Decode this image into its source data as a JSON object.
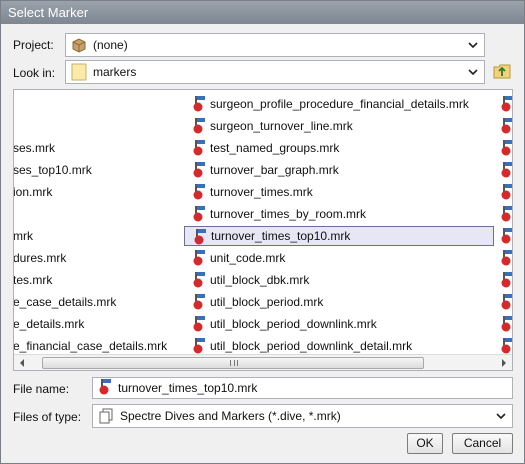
{
  "window": {
    "title": "Select Marker"
  },
  "project": {
    "label": "Project:",
    "value": "(none)"
  },
  "look_in": {
    "label": "Look in:",
    "value": "markers"
  },
  "files": {
    "left_column": [
      "",
      "",
      "ses.mrk",
      "ses_top10.mrk",
      "ion.mrk",
      "",
      "mrk",
      "dures.mrk",
      "tes.mrk",
      "e_case_details.mrk",
      "e_details.mrk",
      "e_financial_case_details.mrk"
    ],
    "middle_column": [
      "surgeon_profile_procedure_financial_details.mrk",
      "surgeon_turnover_line.mrk",
      "test_named_groups.mrk",
      "turnover_bar_graph.mrk",
      "turnover_times.mrk",
      "turnover_times_by_room.mrk",
      "turnover_times_top10.mrk",
      "unit_code.mrk",
      "util_block_dbk.mrk",
      "util_block_period.mrk",
      "util_block_period_downlink.mrk",
      "util_block_period_downlink_detail.mrk"
    ],
    "selected_index": 6
  },
  "file_name": {
    "label": "File name:",
    "value": "turnover_times_top10.mrk"
  },
  "file_type": {
    "label": "Files of type:",
    "value": "Spectre Dives and Markers (*.dive, *.mrk)"
  },
  "buttons": {
    "ok": "OK",
    "cancel": "Cancel"
  },
  "icons": {
    "project": "package-icon",
    "look_in": "folder-icon",
    "up": "up-folder-icon",
    "file": "marker-file-icon",
    "file_type": "file-type-icon"
  },
  "colors": {
    "titlebar": "#8a929c",
    "selection": "#e6e6f5",
    "marker_red": "#d42a2a",
    "marker_blue": "#3a6fc0"
  }
}
